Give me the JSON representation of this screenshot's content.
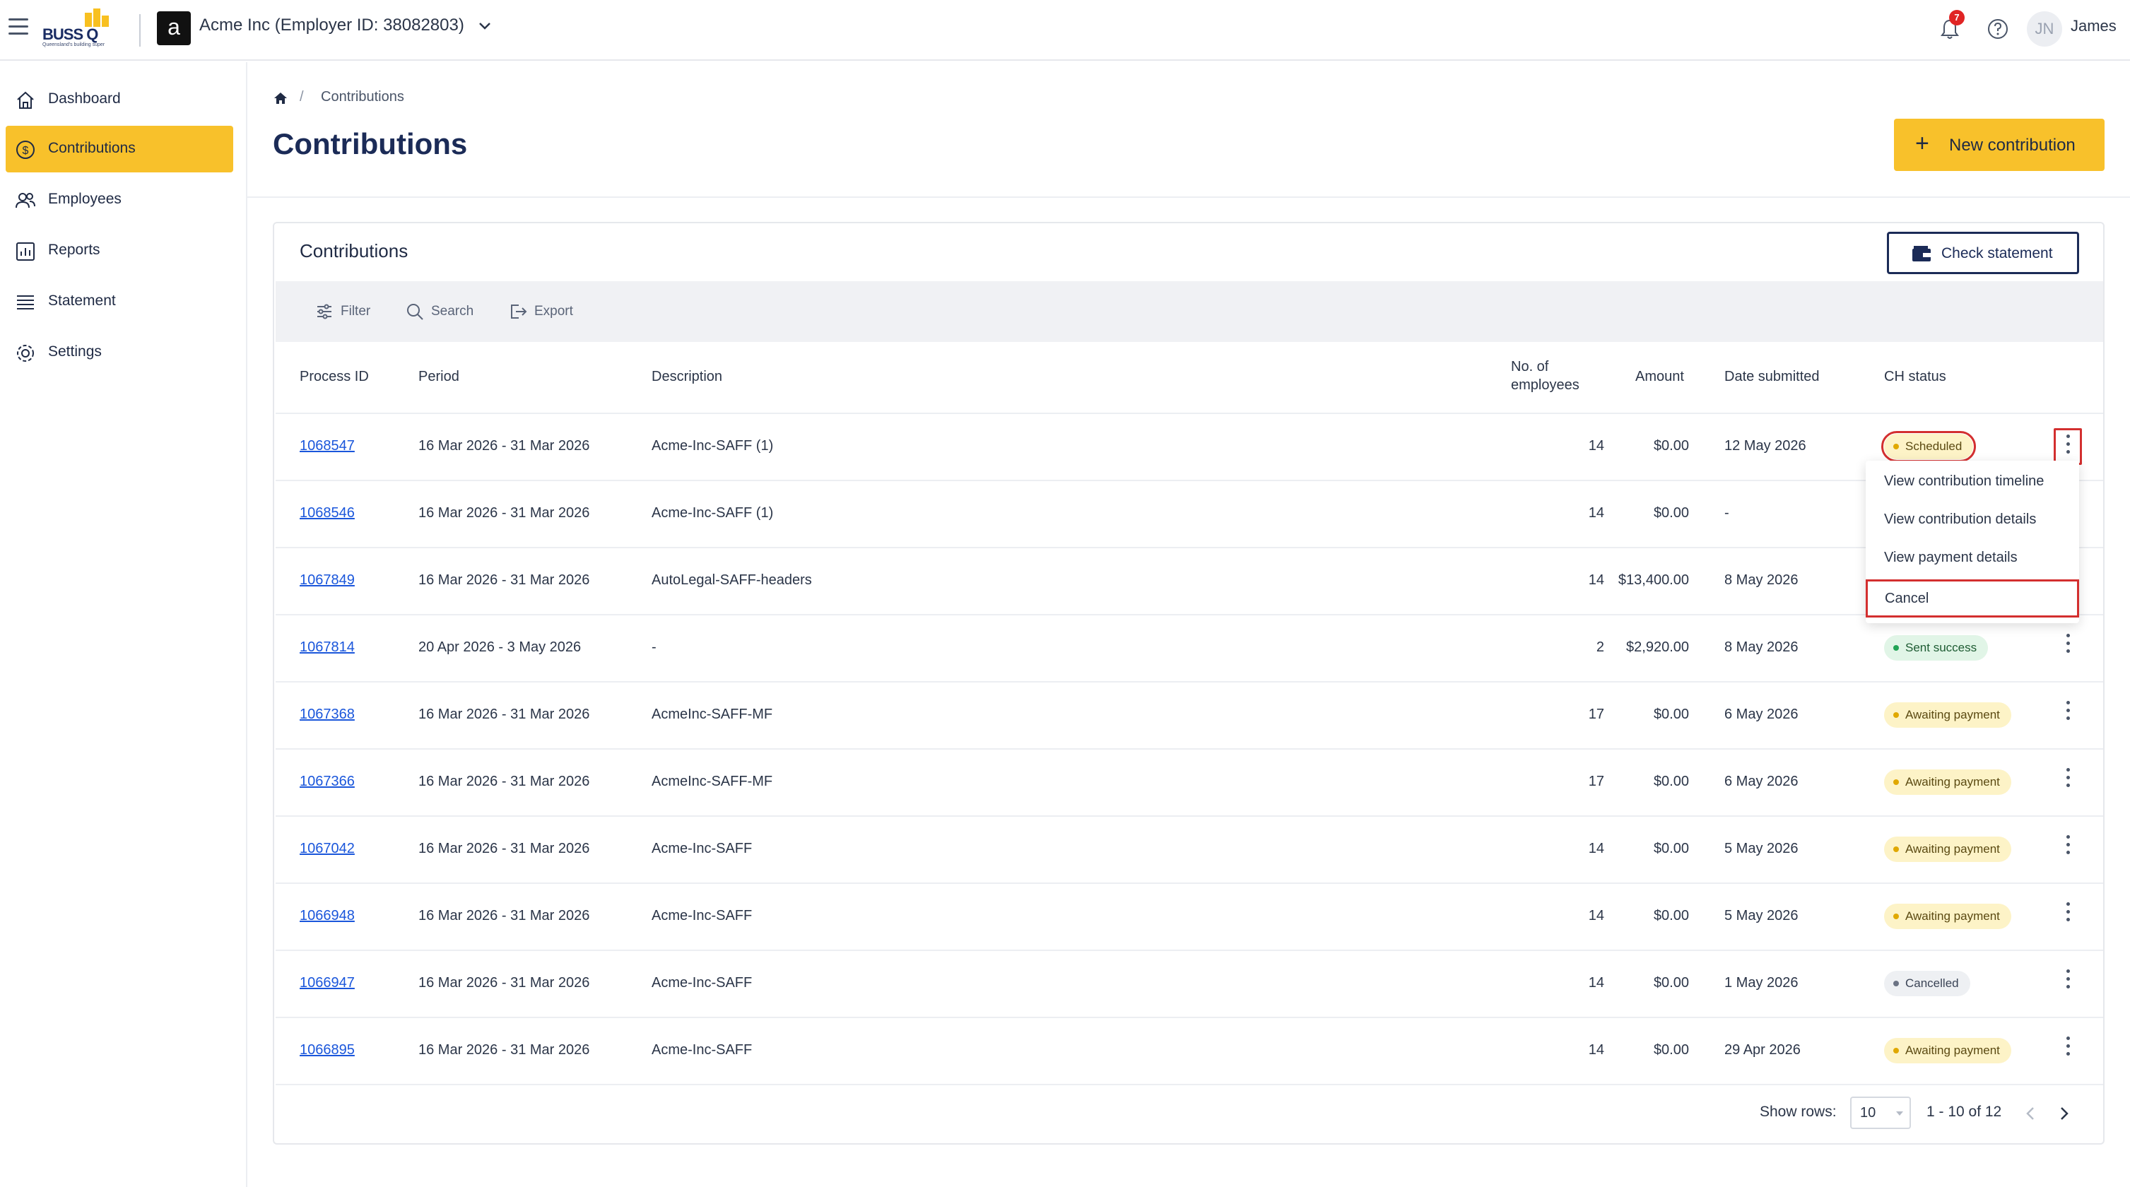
{
  "topbar": {
    "logo_text": "BUSS Q",
    "logo_tagline": "Queensland's building super",
    "employer_avatar_letter": "a",
    "employer_name": "Acme Inc (Employer ID: 38082803)",
    "notification_count": "7",
    "user_initials": "JN",
    "user_name": "James"
  },
  "sidebar": {
    "items": [
      {
        "label": "Dashboard",
        "icon": "home-icon",
        "active": false
      },
      {
        "label": "Contributions",
        "icon": "dollar-circle-icon",
        "active": true
      },
      {
        "label": "Employees",
        "icon": "users-icon",
        "active": false
      },
      {
        "label": "Reports",
        "icon": "bar-chart-icon",
        "active": false
      },
      {
        "label": "Statement",
        "icon": "list-icon",
        "active": false
      },
      {
        "label": "Settings",
        "icon": "gear-icon",
        "active": false
      }
    ]
  },
  "breadcrumb": {
    "separator": "/",
    "current": "Contributions"
  },
  "page": {
    "title": "Contributions",
    "new_button_plus": "+",
    "new_button_label": "New contribution"
  },
  "card": {
    "title": "Contributions",
    "check_statement_label": "Check statement",
    "toolbar": {
      "filter": "Filter",
      "search": "Search",
      "export": "Export"
    }
  },
  "table": {
    "headers": {
      "process_id": "Process ID",
      "period": "Period",
      "description": "Description",
      "employees_line1": "No. of",
      "employees_line2": "employees",
      "amount": "Amount",
      "date_submitted": "Date submitted",
      "ch_status": "CH status"
    },
    "rows": [
      {
        "id": "1068547",
        "period": "16 Mar 2026 - 31 Mar 2026",
        "description": "Acme-Inc-SAFF (1)",
        "employees": "14",
        "amount": "$0.00",
        "date": "12 May 2026",
        "status": "Scheduled",
        "status_color": "yellow"
      },
      {
        "id": "1068546",
        "period": "16 Mar 2026 - 31 Mar 2026",
        "description": "Acme-Inc-SAFF (1)",
        "employees": "14",
        "amount": "$0.00",
        "date": "-",
        "status": "",
        "status_color": ""
      },
      {
        "id": "1067849",
        "period": "16 Mar 2026 - 31 Mar 2026",
        "description": "AutoLegal-SAFF-headers",
        "employees": "14",
        "amount": "$13,400.00",
        "date": "8 May 2026",
        "status": "",
        "status_color": ""
      },
      {
        "id": "1067814",
        "period": "20 Apr 2026 - 3 May 2026",
        "description": "-",
        "employees": "2",
        "amount": "$2,920.00",
        "date": "8 May 2026",
        "status": "Sent success",
        "status_color": "green"
      },
      {
        "id": "1067368",
        "period": "16 Mar 2026 - 31 Mar 2026",
        "description": "AcmeInc-SAFF-MF",
        "employees": "17",
        "amount": "$0.00",
        "date": "6 May 2026",
        "status": "Awaiting payment",
        "status_color": "yellow"
      },
      {
        "id": "1067366",
        "period": "16 Mar 2026 - 31 Mar 2026",
        "description": "AcmeInc-SAFF-MF",
        "employees": "17",
        "amount": "$0.00",
        "date": "6 May 2026",
        "status": "Awaiting payment",
        "status_color": "yellow"
      },
      {
        "id": "1067042",
        "period": "16 Mar 2026 - 31 Mar 2026",
        "description": "Acme-Inc-SAFF",
        "employees": "14",
        "amount": "$0.00",
        "date": "5 May 2026",
        "status": "Awaiting payment",
        "status_color": "yellow"
      },
      {
        "id": "1066948",
        "period": "16 Mar 2026 - 31 Mar 2026",
        "description": "Acme-Inc-SAFF",
        "employees": "14",
        "amount": "$0.00",
        "date": "5 May 2026",
        "status": "Awaiting payment",
        "status_color": "yellow"
      },
      {
        "id": "1066947",
        "period": "16 Mar 2026 - 31 Mar 2026",
        "description": "Acme-Inc-SAFF",
        "employees": "14",
        "amount": "$0.00",
        "date": "1 May 2026",
        "status": "Cancelled",
        "status_color": "grey"
      },
      {
        "id": "1066895",
        "period": "16 Mar 2026 - 31 Mar 2026",
        "description": "Acme-Inc-SAFF",
        "employees": "14",
        "amount": "$0.00",
        "date": "29 Apr 2026",
        "status": "Awaiting payment",
        "status_color": "yellow"
      }
    ]
  },
  "row_menu": {
    "items": [
      "View contribution timeline",
      "View contribution details",
      "View payment details",
      "Cancel"
    ]
  },
  "pagination": {
    "show_rows_label": "Show rows:",
    "rows_value": "10",
    "range": "1 - 10 of 12"
  },
  "colors": {
    "accent": "#f8c12b",
    "navy": "#1b2b57",
    "link": "#1a56db",
    "highlight": "#d32f2f"
  }
}
